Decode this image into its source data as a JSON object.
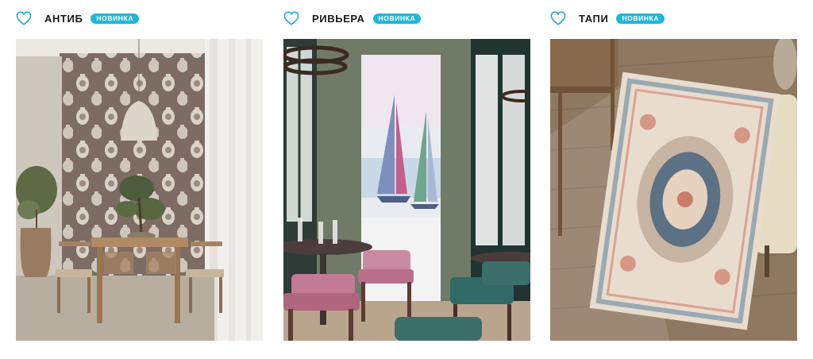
{
  "products": [
    {
      "title": "АНТИБ",
      "badge": "НОВИНКА",
      "image": "dining room with patterned vase wallpaper, wooden table and pendant lamp"
    },
    {
      "title": "РИВЬЕРА",
      "badge": "НОВИНКА",
      "image": "restaurant interior with sailboat watercolor mural, pink and teal chairs"
    },
    {
      "title": "ТАПИ",
      "badge": "НОВИНКА",
      "image": "ornamental area rug on wooden floor with tufted bench"
    }
  ],
  "icons": {
    "favorite": "heart-outline-icon"
  },
  "colors": {
    "badge_bg": "#1fb6de",
    "heart_stroke": "#2aa7d3",
    "title": "#1b1b1b"
  }
}
